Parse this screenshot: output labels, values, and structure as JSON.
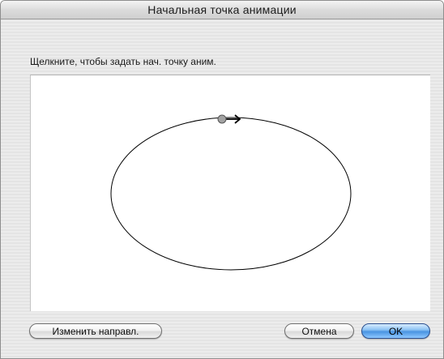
{
  "dialog": {
    "title": "Начальная точка анимации",
    "instruction": "Щелкните, чтобы задать нач. точку аним."
  },
  "buttons": {
    "change_direction": "Изменить направл.",
    "cancel": "Отмена",
    "ok": "OK"
  },
  "colors": {
    "start_point": "#a3a3a3",
    "default_button": "#4a94e2"
  },
  "icons": {
    "start_point": "start-point-icon",
    "direction_arrow": "direction-arrow-icon"
  }
}
